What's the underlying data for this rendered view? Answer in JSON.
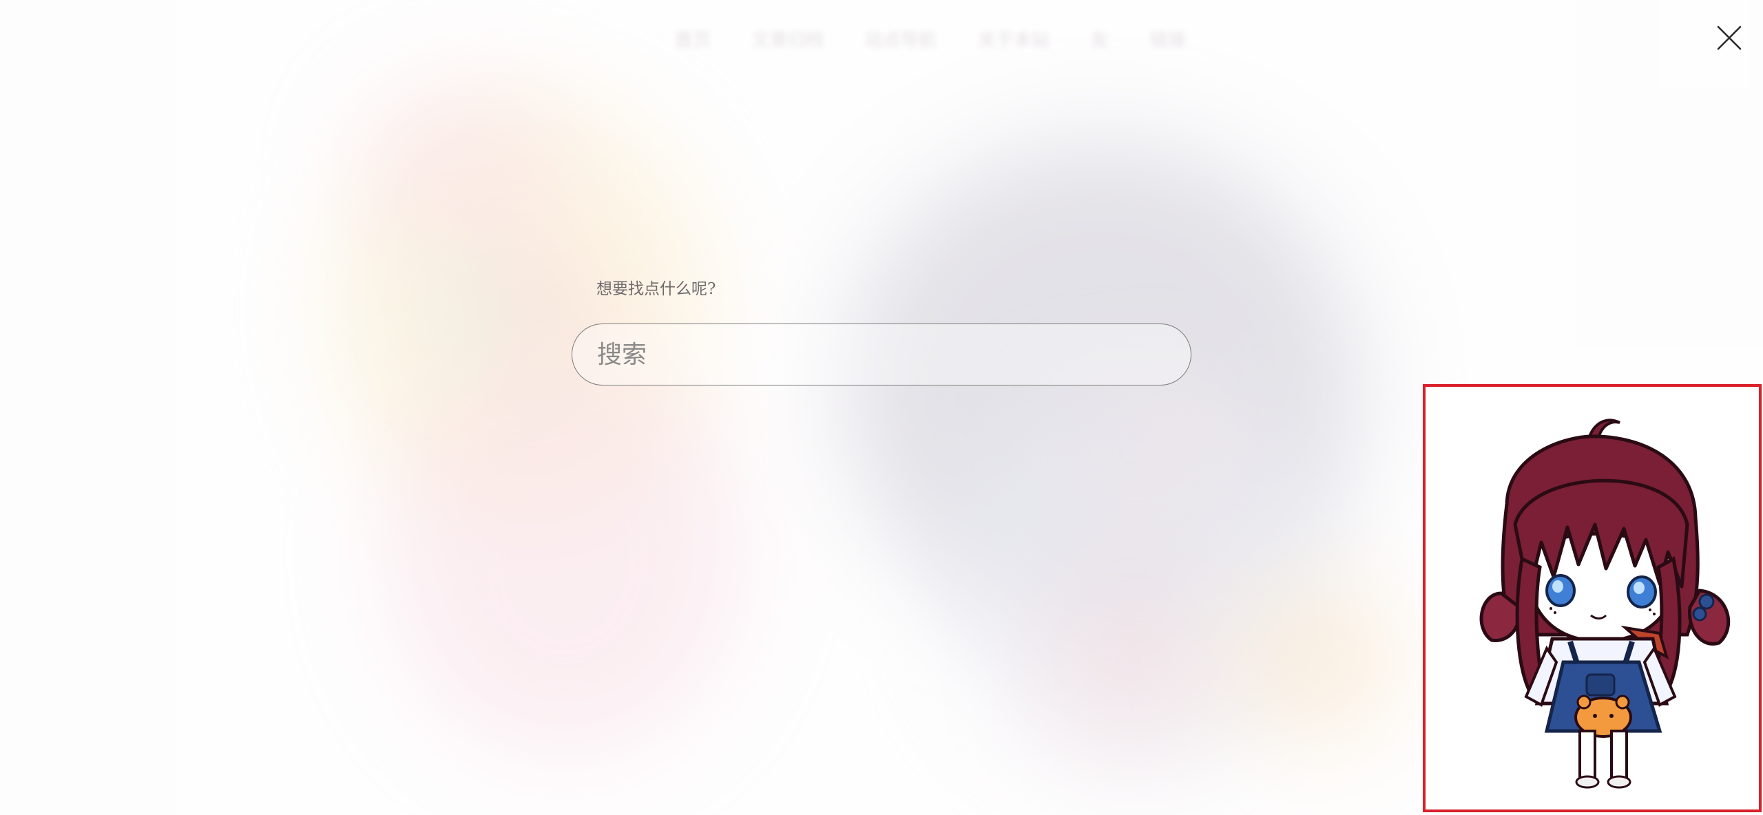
{
  "nav": {
    "items": [
      "首页",
      "文章归档",
      "站点导航",
      "关于本站",
      "友",
      "链接"
    ]
  },
  "search": {
    "prompt": "想要找点什么呢?",
    "placeholder": "搜索",
    "value": ""
  },
  "icons": {
    "close": "close-icon",
    "mascot": "chibi-girl-mascot"
  },
  "colors": {
    "highlight_border": "#d9202b",
    "input_border": "#7a7a7a",
    "mascot_hair": "#7a1f35",
    "mascot_overalls": "#2d4f93"
  }
}
